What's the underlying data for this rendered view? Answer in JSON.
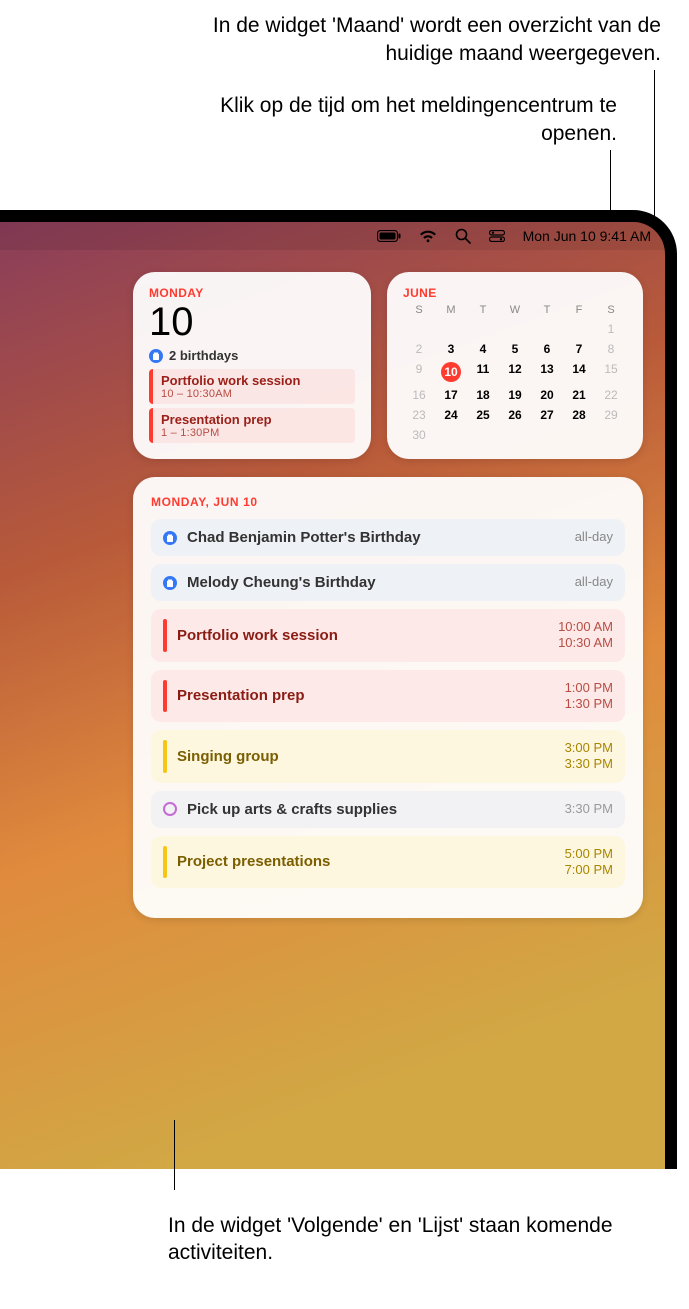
{
  "callouts": {
    "month": "In de widget 'Maand' wordt een overzicht van de huidige maand weergegeven.",
    "clock": "Klik op de tijd om het meldingencentrum te openen.",
    "list": "In de widget 'Volgende' en 'Lijst' staan komende activiteiten."
  },
  "menubar": {
    "datetime": "Mon Jun 10  9:41 AM"
  },
  "today_widget": {
    "weekday": "MONDAY",
    "daynum": "10",
    "birthdays_label": "2 birthdays",
    "events": [
      {
        "title": "Portfolio work session",
        "time": "10 – 10:30AM"
      },
      {
        "title": "Presentation prep",
        "time": "1 – 1:30PM"
      }
    ]
  },
  "month_widget": {
    "title": "JUNE",
    "dow": [
      "S",
      "M",
      "T",
      "W",
      "T",
      "F",
      "S"
    ],
    "weeks": [
      [
        null,
        null,
        null,
        null,
        null,
        null,
        1
      ],
      [
        2,
        3,
        4,
        5,
        6,
        7,
        8
      ],
      [
        9,
        10,
        11,
        12,
        13,
        14,
        15
      ],
      [
        16,
        17,
        18,
        19,
        20,
        21,
        22
      ],
      [
        23,
        24,
        25,
        26,
        27,
        28,
        29
      ],
      [
        30,
        null,
        null,
        null,
        null,
        null,
        null
      ]
    ],
    "today": 10,
    "out_days": [
      1,
      2,
      8,
      9,
      15,
      16,
      22,
      23,
      29,
      30
    ]
  },
  "list_widget": {
    "heading": "MONDAY, JUN 10",
    "events": [
      {
        "kind": "birthday",
        "title": "Chad Benjamin Potter's Birthday",
        "time_single": "all-day"
      },
      {
        "kind": "birthday",
        "title": "Melody Cheung's Birthday",
        "time_single": "all-day"
      },
      {
        "kind": "red",
        "title": "Portfolio work session",
        "time_start": "10:00 AM",
        "time_end": "10:30 AM"
      },
      {
        "kind": "red",
        "title": "Presentation prep",
        "time_start": "1:00 PM",
        "time_end": "1:30 PM"
      },
      {
        "kind": "yellow",
        "title": "Singing group",
        "time_start": "3:00 PM",
        "time_end": "3:30 PM"
      },
      {
        "kind": "purple",
        "title": "Pick up arts & crafts supplies",
        "time_single": "3:30 PM"
      },
      {
        "kind": "yellow",
        "title": "Project presentations",
        "time_start": "5:00 PM",
        "time_end": "7:00 PM"
      }
    ]
  }
}
